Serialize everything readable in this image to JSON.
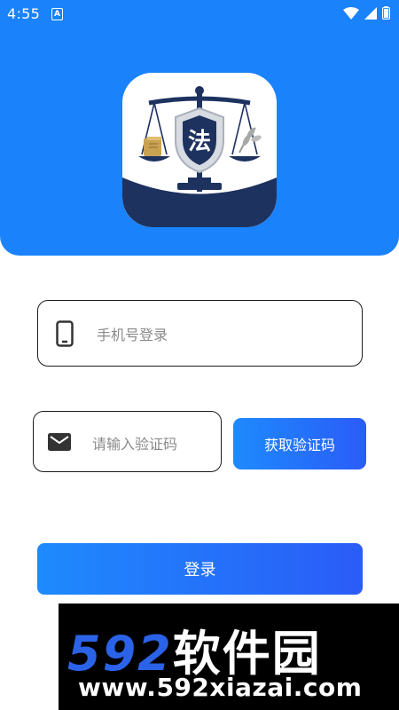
{
  "status_bar": {
    "time": "4:55",
    "notification_badge": "A"
  },
  "logo": {
    "emblem_char": "法"
  },
  "phone_field": {
    "placeholder": "手机号登录",
    "value": ""
  },
  "code_field": {
    "placeholder": "请输入验证码",
    "value": ""
  },
  "get_code_button": {
    "label": "获取验证码"
  },
  "login_button": {
    "label": "登录"
  },
  "watermark": {
    "brand_number": "592",
    "brand_text": "软件园",
    "url": "www.592xiazai.com"
  },
  "colors": {
    "primary": "#1a82fb",
    "logo_navy": "#1e3260",
    "button_end": "#2a5cf7"
  }
}
